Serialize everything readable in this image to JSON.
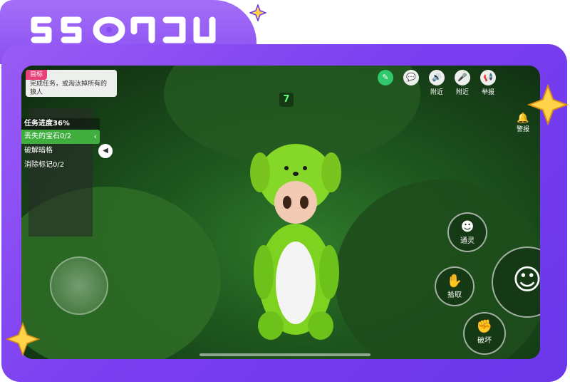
{
  "logo_text": "55ЯОЗU",
  "hud": {
    "objective": {
      "tag": "目标",
      "text": "完成任务，或淘汰掉所有的狼人"
    },
    "task_progress": "任务进度36%",
    "tasks": [
      {
        "label": "丢失的宝石0/2",
        "active": true
      },
      {
        "label": "破解暗格",
        "active": false
      },
      {
        "label": "消除标记0/2",
        "active": false
      }
    ],
    "counter": "7",
    "top_buttons": [
      {
        "icon": "note-icon",
        "label": ""
      },
      {
        "icon": "chat-icon",
        "label": ""
      },
      {
        "icon": "speaker-icon",
        "label": "附近"
      },
      {
        "icon": "mic-icon",
        "label": "附近"
      },
      {
        "icon": "report-icon",
        "label": "举报"
      }
    ],
    "alarm_label": "警报",
    "skills": [
      {
        "icon": "ghost-icon",
        "label": "通灵"
      },
      {
        "icon": "grab-icon",
        "label": "拾取"
      },
      {
        "icon": "hand-icon",
        "label": "破坏"
      }
    ]
  },
  "colors": {
    "frame": "#7b3ff0",
    "accent_green": "#3fae3f",
    "objective_tag": "#e8407a"
  }
}
